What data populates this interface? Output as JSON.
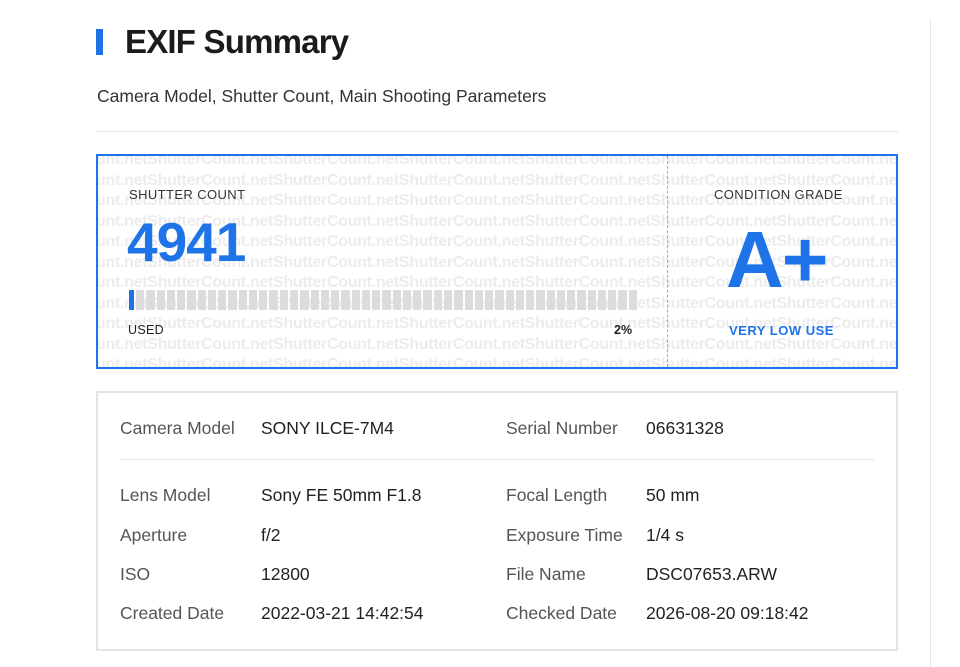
{
  "header": {
    "title": "EXIF Summary",
    "subtitle": "Camera Model, Shutter Count, Main Shooting Parameters"
  },
  "shutter": {
    "count_label": "SHUTTER COUNT",
    "count_value": "4941",
    "used_label": "USED",
    "used_percent": "2%",
    "used_fraction": 0.02,
    "grade_label": "CONDITION GRADE",
    "grade": "A+",
    "grade_desc": "VERY LOW USE",
    "watermark_text": "ShutterCount.net"
  },
  "details": {
    "primary": [
      {
        "label": "Camera Model",
        "value": "SONY ILCE-7M4"
      },
      {
        "label": "Serial Number",
        "value": "06631328"
      }
    ],
    "rows": [
      [
        {
          "label": "Lens Model",
          "value": "Sony FE 50mm F1.8"
        },
        {
          "label": "Focal Length",
          "value": "50 mm"
        }
      ],
      [
        {
          "label": "Aperture",
          "value": "f/2"
        },
        {
          "label": "Exposure Time",
          "value": "1/4 s"
        }
      ],
      [
        {
          "label": "ISO",
          "value": "12800"
        },
        {
          "label": "File Name",
          "value": "DSC07653.ARW"
        }
      ],
      [
        {
          "label": "Created Date",
          "value": "2022-03-21 14:42:54"
        },
        {
          "label": "Checked Date",
          "value": "2026-08-20 09:18:42"
        }
      ]
    ]
  },
  "colors": {
    "accent": "#1e73e8",
    "bar_empty": "#dcdcdc",
    "watermark": "#ececec"
  }
}
